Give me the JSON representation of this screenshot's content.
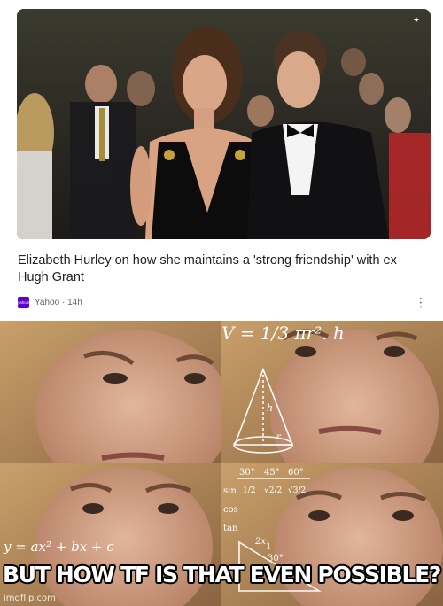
{
  "article": {
    "headline": "Elizabeth Hurley on how she maintains a 'strong friendship' with ex Hugh Grant",
    "source_name": "Yahoo",
    "source_logo_text": "yahoo!",
    "separator": "·",
    "age": "14h",
    "more_glyph": "⋮",
    "badge_glyph": "✦"
  },
  "meme": {
    "caption": "BUT HOW TF IS THAT EVEN POSSIBLE?",
    "watermark": "imgflip.com",
    "math": {
      "volume_formula": "V = 1/3 πr². h",
      "quadratic": "y = ax² + bx + c",
      "cone_h": "h",
      "cone_r": "r",
      "trig_sin": "sin",
      "trig_cos": "cos",
      "trig_tan": "tan",
      "angle_30": "30°",
      "angle_45": "45°",
      "angle_60": "60°",
      "frac_1_2": "1/2",
      "frac_r2_2": "√2/2",
      "frac_r3_2": "√3/2",
      "val_1": "1",
      "val_2x": "2x",
      "val_30": "30°"
    }
  },
  "colors": {
    "headline": "#202124",
    "meta": "#5f6368",
    "yahoo_purple": "#6001d2"
  }
}
